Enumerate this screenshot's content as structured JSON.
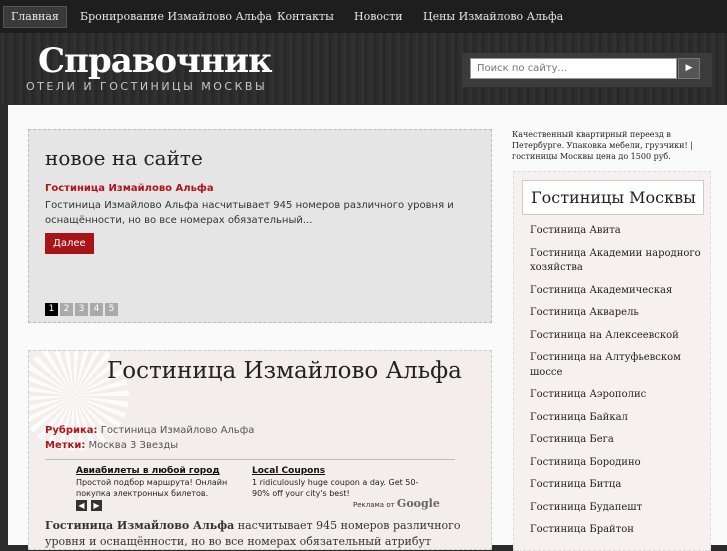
{
  "nav": {
    "items": [
      {
        "label": "Главная",
        "active": true
      },
      {
        "label": "Бронирование Измайлово Альфа"
      },
      {
        "label": "Контакты"
      },
      {
        "label": "Новости"
      },
      {
        "label": "Цены Измайлово Альфа"
      }
    ]
  },
  "header": {
    "title": "Справочник",
    "subtitle": "ОТЕЛИ И ГОСТИНИЦЫ МОСКВЫ",
    "search_placeholder": "Поиск по сайту...",
    "search_button_icon": "play-arrow-icon"
  },
  "featured": {
    "title": "новое на сайте",
    "post_link": "Гостиница Измайлово Альфа",
    "excerpt": "Гостиница Измайлово Альфа насчитывает 945 номеров различного уровня и оснащённости, но во все номерах обязательный...",
    "more_label": "Далее",
    "pages": [
      "1",
      "2",
      "3",
      "4",
      "5"
    ],
    "current_page": "1"
  },
  "post": {
    "title": "Гостиница Измайлово Альфа",
    "category_label": "Рубрика:",
    "category_value": "Гостиница Измайлово Альфа",
    "tags_label": "Метки:",
    "tags_value": "Москва 3 Звезды",
    "ads": [
      {
        "headline": "Авиабилеты в любой город",
        "text": "Простой подбор маршрута! Онлайн покупка электронных билетов."
      },
      {
        "headline": "Local Coupons",
        "text": "1 ridiculously huge coupon a day. Get 50-90% off your city's best!"
      }
    ],
    "ads_by": "Реклама от",
    "ads_brand": "Google",
    "body_bold": "Гостиница Измайлово Альфа",
    "body_rest": " насчитывает 945 номеров различного уровня и оснащённости, но во все номерах обязательный атрибут минибар, телефон,"
  },
  "sidebar": {
    "ad_text": "Качественный квартирный переезд в Петербурге. Упаковка мебели, грузчики! | гостиницы Москвы цена до 1500 руб.",
    "widget_title": "Гостиницы Москвы",
    "hotels": [
      "Гостиница Авита",
      "Гостиница Академии народного хозяйства",
      "Гостиница Академическая",
      "Гостиница Акварель",
      "Гостиница на Алексеевской",
      "Гостиница на Алтуфьевском шоссе",
      "Гостиница Аэрополис",
      "Гостиница Байкал",
      "Гостиница Бега",
      "Гостиница Бородино",
      "Гостиница Битца",
      "Гостиница Будапешт",
      "Гостиница Брайтон"
    ]
  },
  "colors": {
    "accent": "#a81418",
    "header_bg": "#2c2c2c",
    "nav_bg": "#1e1e1e"
  }
}
